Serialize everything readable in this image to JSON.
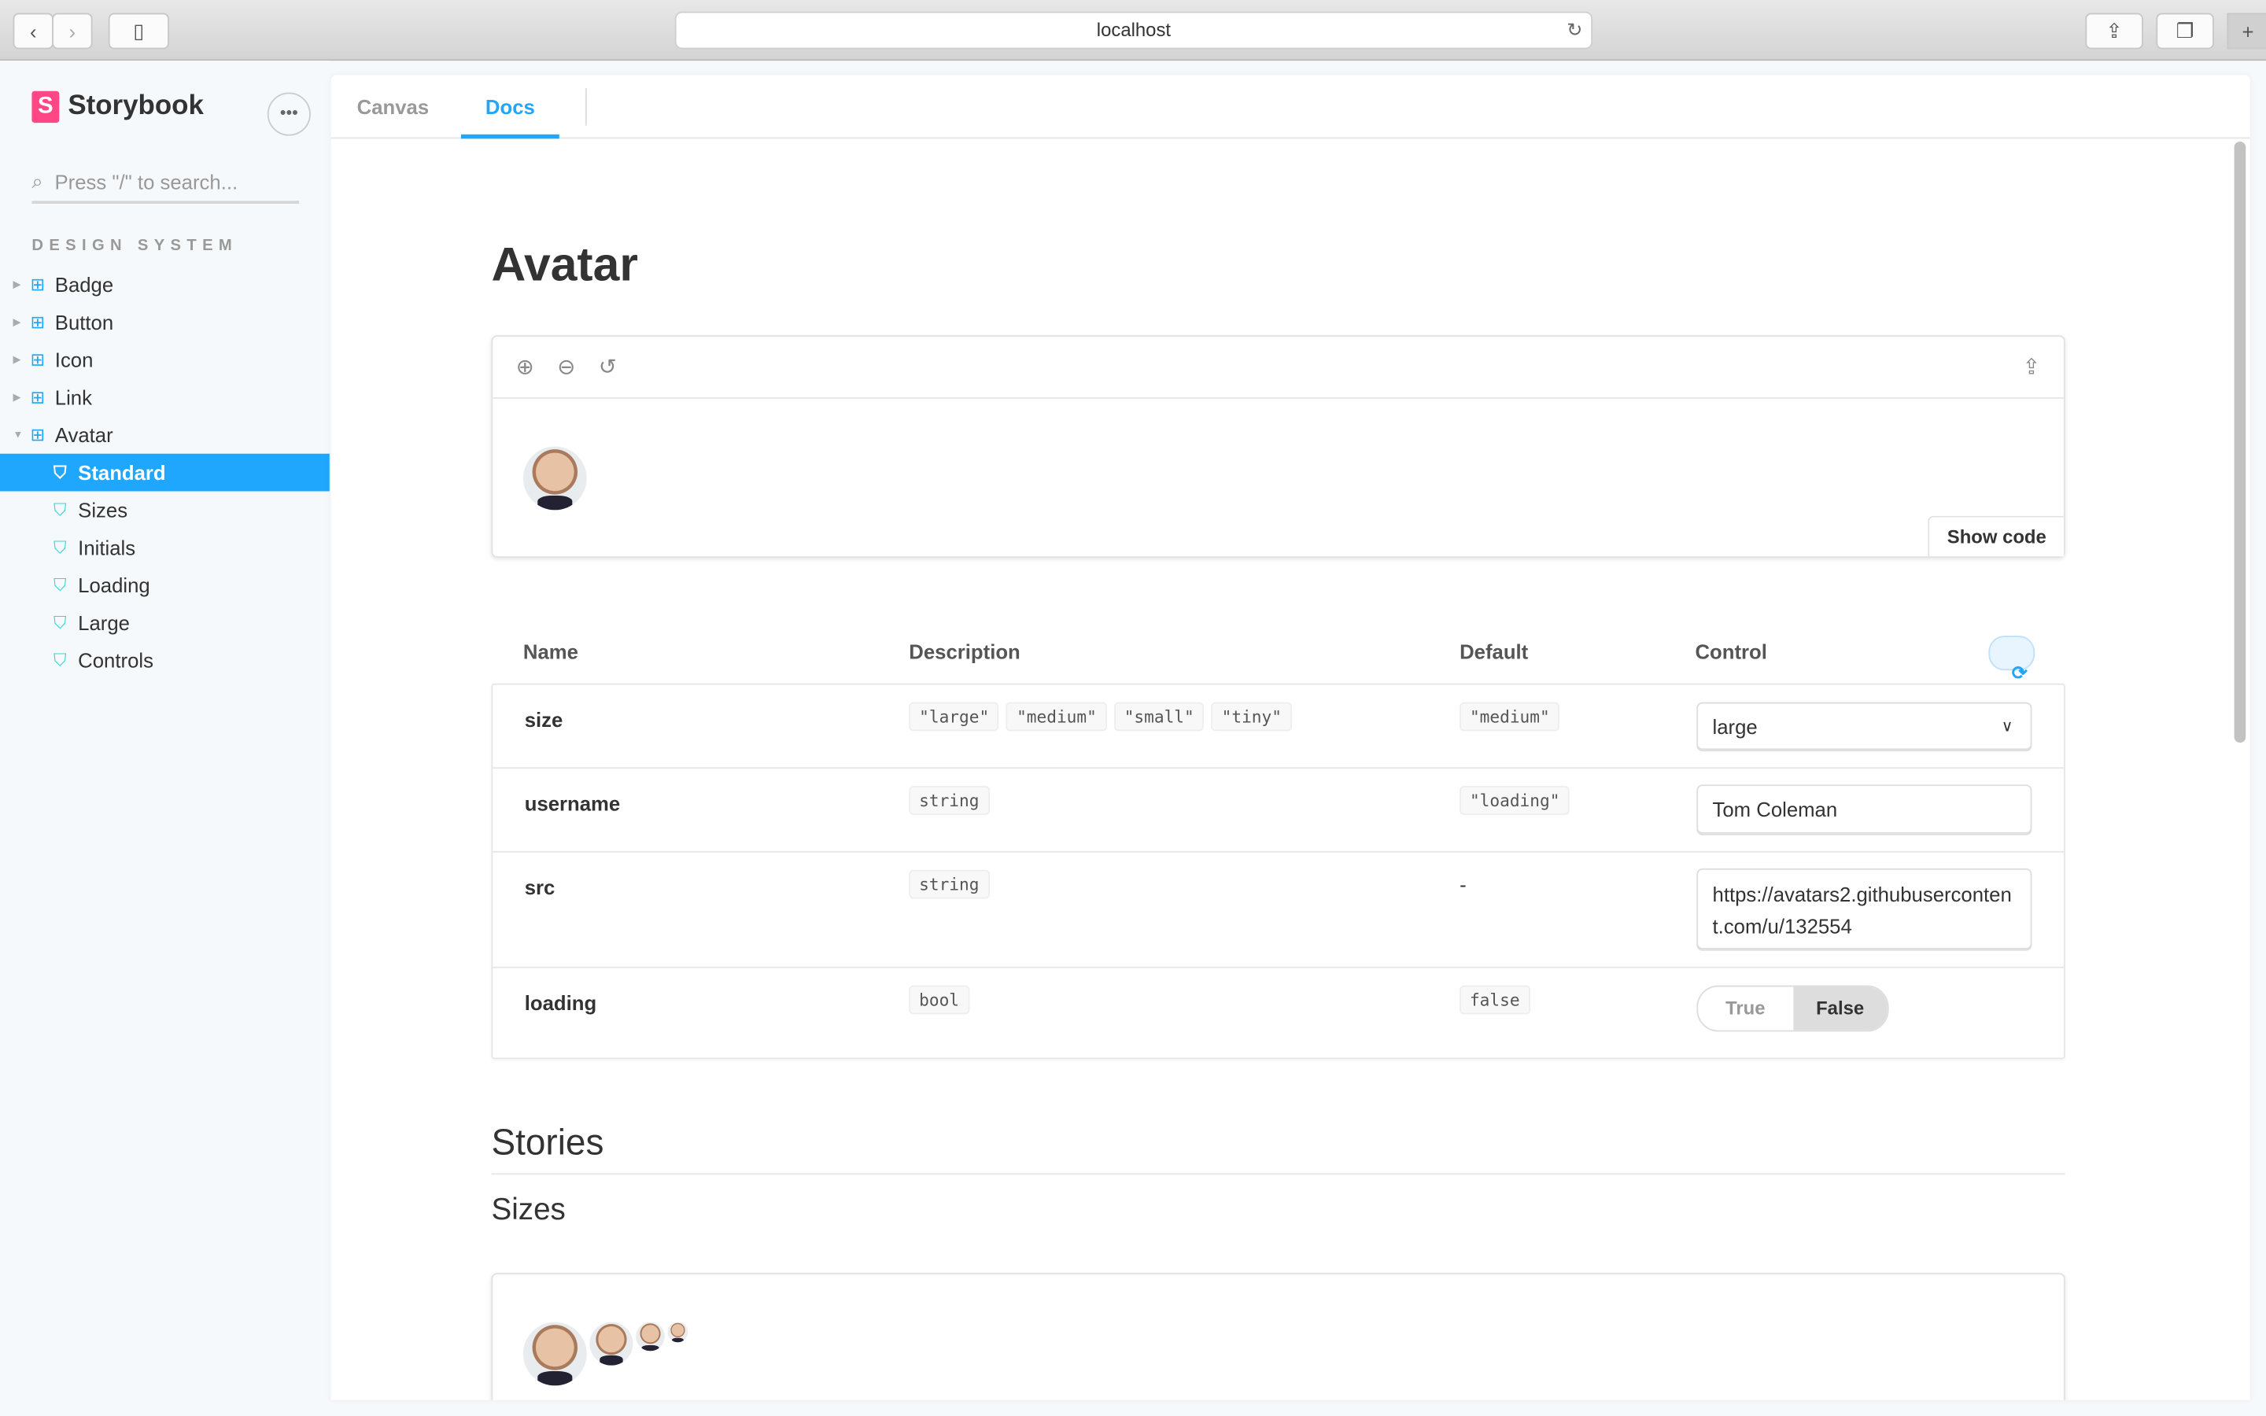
{
  "browser": {
    "url": "localhost",
    "back_icon": "chevron-left",
    "forward_icon": "chevron-right"
  },
  "sidebar": {
    "brand": "Storybook",
    "search_placeholder": "Press \"/\" to search...",
    "section": "DESIGN SYSTEM",
    "components": [
      {
        "label": "Badge"
      },
      {
        "label": "Button"
      },
      {
        "label": "Icon"
      },
      {
        "label": "Link"
      },
      {
        "label": "Avatar"
      }
    ],
    "stories": [
      {
        "label": "Standard",
        "selected": true
      },
      {
        "label": "Sizes"
      },
      {
        "label": "Initials"
      },
      {
        "label": "Loading"
      },
      {
        "label": "Large"
      },
      {
        "label": "Controls"
      }
    ]
  },
  "tabs": [
    {
      "label": "Canvas"
    },
    {
      "label": "Docs",
      "active": true
    }
  ],
  "docs": {
    "title": "Avatar",
    "show_code": "Show code",
    "headers": {
      "name": "Name",
      "description": "Description",
      "default": "Default",
      "control": "Control"
    },
    "props": [
      {
        "name": "size",
        "desc": [
          "\"large\"",
          "\"medium\"",
          "\"small\"",
          "\"tiny\""
        ],
        "default": "\"medium\"",
        "control": "large"
      },
      {
        "name": "username",
        "desc": [
          "string"
        ],
        "default": "\"loading\"",
        "control": "Tom Coleman"
      },
      {
        "name": "src",
        "desc": [
          "string"
        ],
        "default": "-",
        "control": "https://avatars2.githubusercontent.com/u/132554"
      },
      {
        "name": "loading",
        "desc": [
          "bool"
        ],
        "default": "false",
        "control_true": "True",
        "control_false": "False",
        "value": false
      }
    ],
    "stories_heading": "Stories",
    "sizes_heading": "Sizes"
  },
  "colors": {
    "accent": "#1ea7fd",
    "brand": "#ff4785"
  }
}
